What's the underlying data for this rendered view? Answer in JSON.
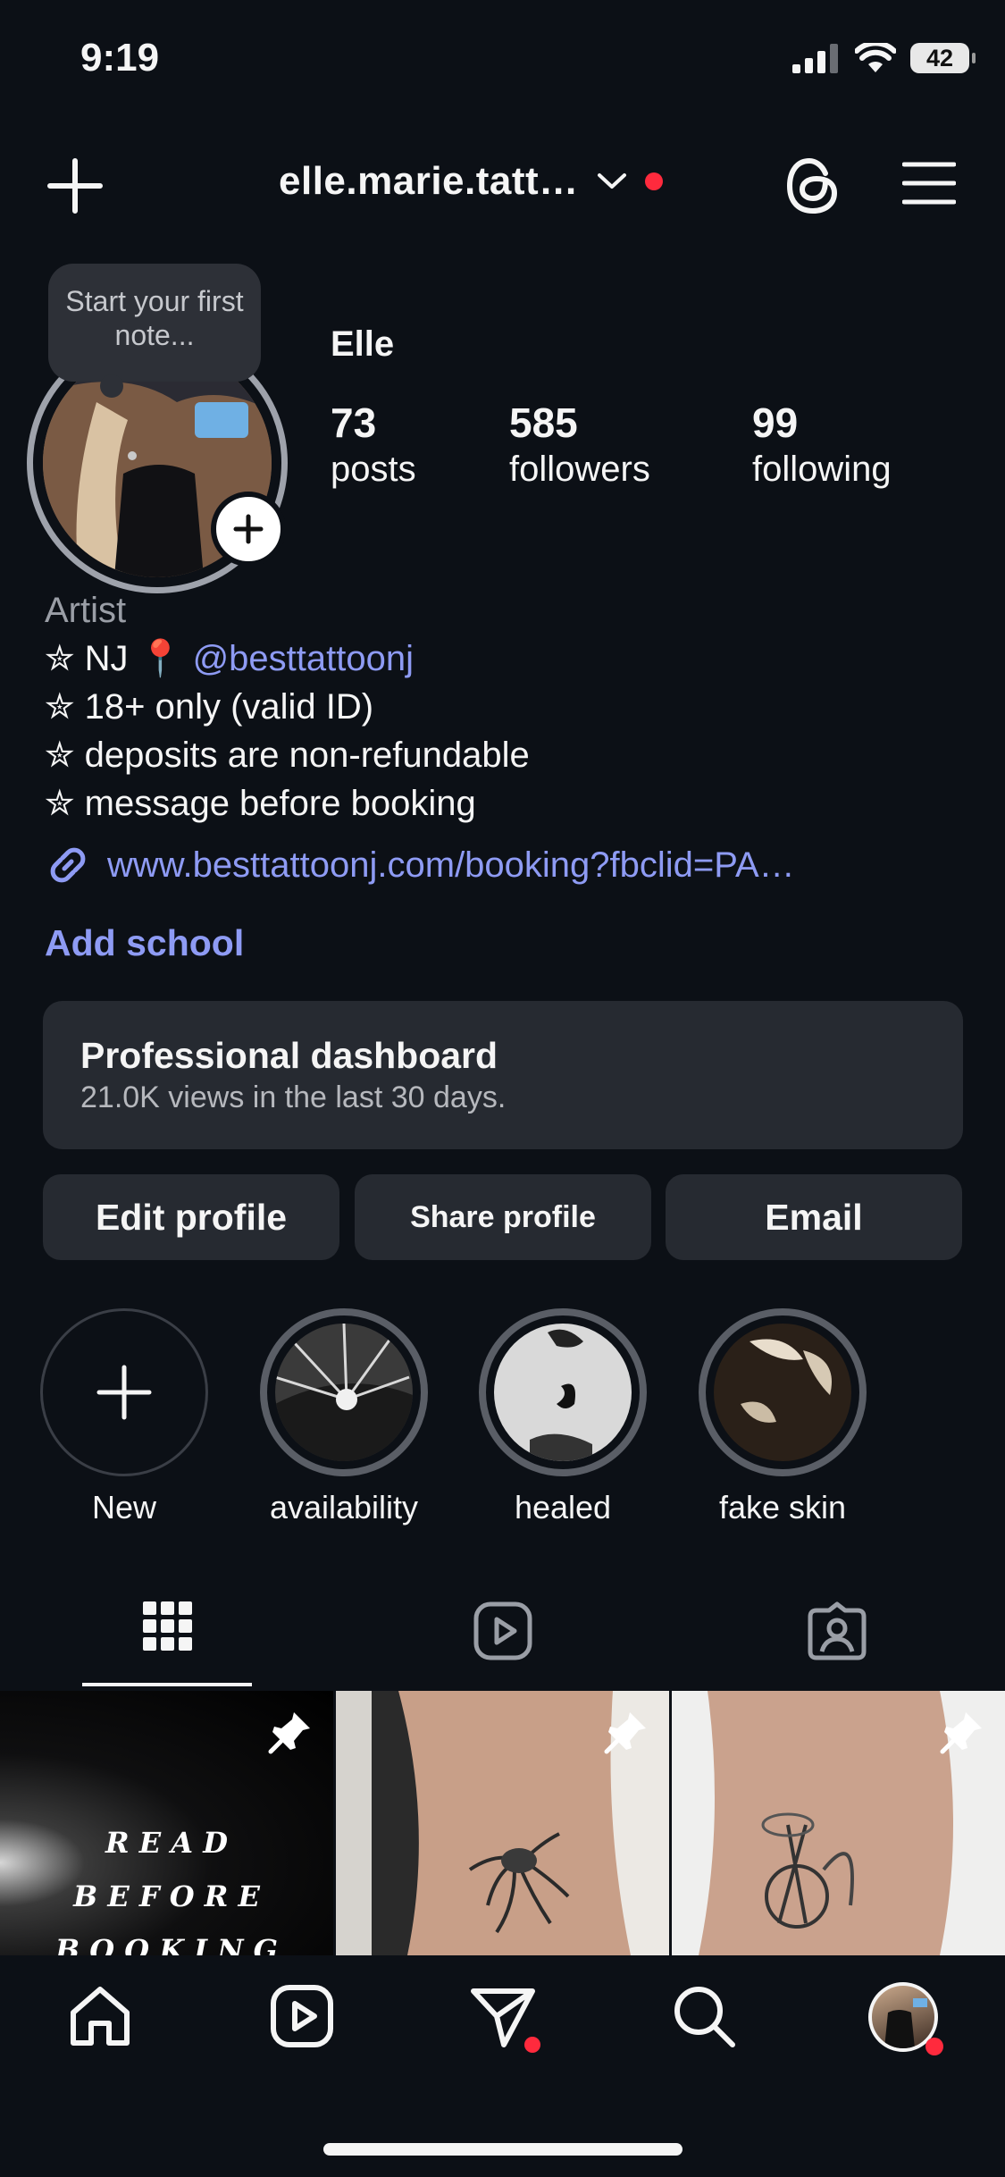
{
  "status_bar": {
    "time": "9:19",
    "battery": "42"
  },
  "header": {
    "username": "elle.marie.tatt…"
  },
  "profile": {
    "note_placeholder": "Start your first note...",
    "display_name": "Elle",
    "stats": [
      {
        "value": "73",
        "label": "posts"
      },
      {
        "value": "585",
        "label": "followers"
      },
      {
        "value": "99",
        "label": "following"
      }
    ]
  },
  "bio": {
    "category": "Artist",
    "line1_prefix": "✮ NJ",
    "line1_emoji": "📍",
    "line1_mention": "@besttattoonj",
    "lines": [
      "✮ 18+ only (valid ID)",
      "✮ deposits are non-refundable",
      "✮ message before booking"
    ],
    "link": "www.besttattoonj.com/booking?fbclid=PA…",
    "add_school": "Add school"
  },
  "dashboard": {
    "title": "Professional dashboard",
    "subtitle": "21.0K views in the last 30 days."
  },
  "actions": {
    "edit": "Edit profile",
    "share": "Share profile",
    "email": "Email"
  },
  "highlights": [
    {
      "label": "New"
    },
    {
      "label": "availability"
    },
    {
      "label": "healed"
    },
    {
      "label": "fake skin"
    }
  ],
  "posts": {
    "tile1_text": [
      "R E A D",
      "B E F O R E",
      "B O O K I N G"
    ]
  },
  "colors": {
    "background": "#0c1016",
    "accent_link": "#8e9bf4",
    "notification": "#ff2a3d",
    "surface": "#262a31"
  }
}
